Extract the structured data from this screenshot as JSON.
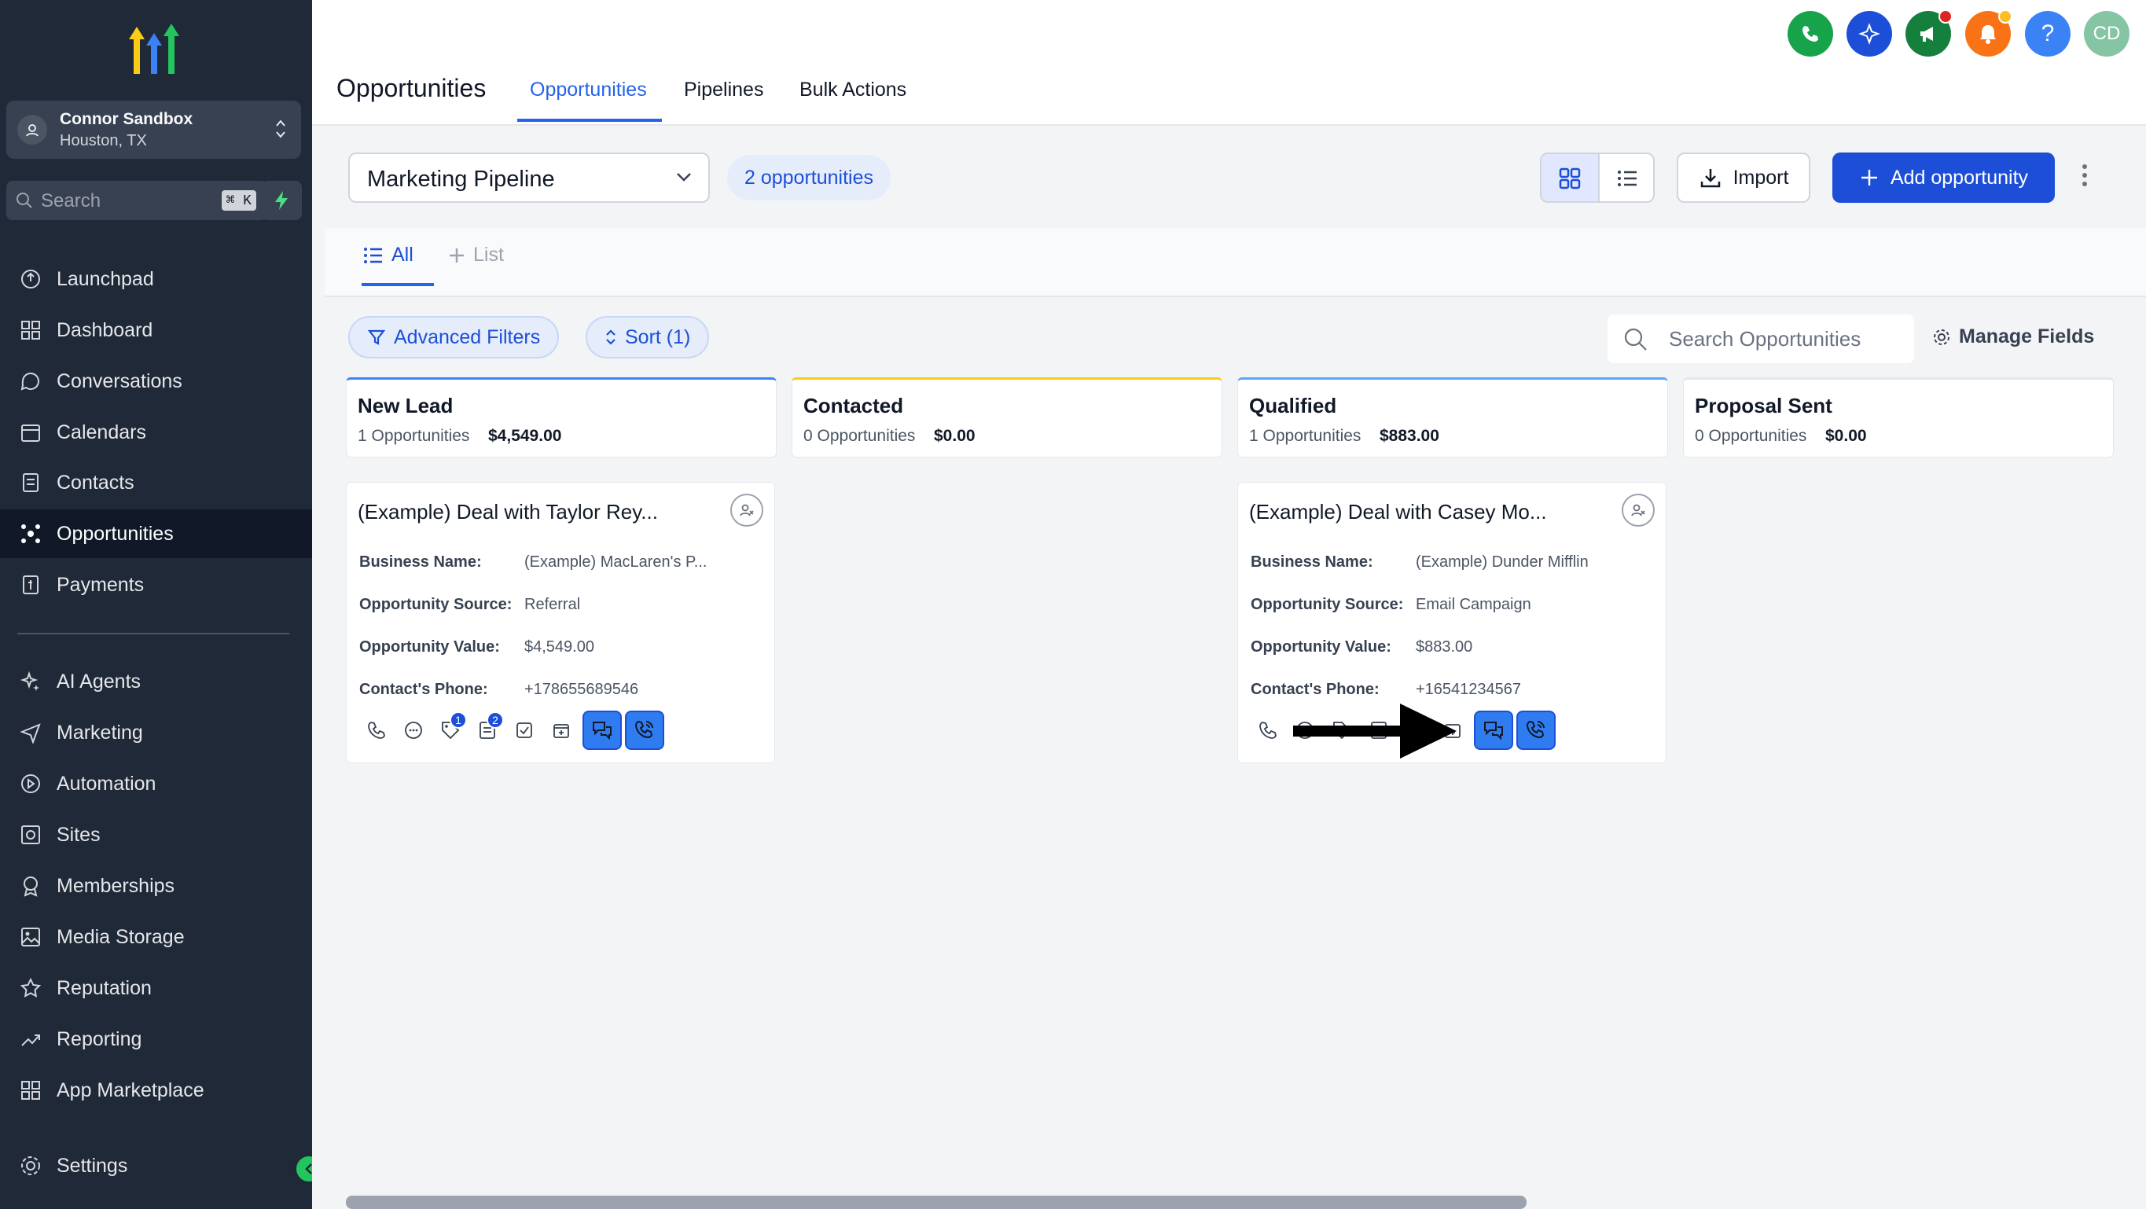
{
  "account": {
    "name": "Connor Sandbox",
    "location": "Houston, TX"
  },
  "search": {
    "placeholder": "Search",
    "shortcut": "⌘ K"
  },
  "sidebar": {
    "items": [
      {
        "label": "Launchpad",
        "icon": "launchpad-icon"
      },
      {
        "label": "Dashboard",
        "icon": "dashboard-icon"
      },
      {
        "label": "Conversations",
        "icon": "chat-icon"
      },
      {
        "label": "Calendars",
        "icon": "calendar-icon"
      },
      {
        "label": "Contacts",
        "icon": "contacts-icon"
      },
      {
        "label": "Opportunities",
        "icon": "opportunities-icon",
        "active": true
      },
      {
        "label": "Payments",
        "icon": "payments-icon"
      },
      {
        "label": "AI Agents",
        "icon": "sparkle-icon"
      },
      {
        "label": "Marketing",
        "icon": "send-icon"
      },
      {
        "label": "Automation",
        "icon": "automation-icon"
      },
      {
        "label": "Sites",
        "icon": "sites-icon"
      },
      {
        "label": "Memberships",
        "icon": "award-icon"
      },
      {
        "label": "Media Storage",
        "icon": "image-icon"
      },
      {
        "label": "Reputation",
        "icon": "star-icon"
      },
      {
        "label": "Reporting",
        "icon": "trend-icon"
      },
      {
        "label": "App Marketplace",
        "icon": "grid-icon"
      }
    ],
    "settings": "Settings"
  },
  "header": {
    "title": "Opportunities",
    "tabs": [
      "Opportunities",
      "Pipelines",
      "Bulk Actions"
    ],
    "avatar_initials": "CD"
  },
  "toolbar": {
    "pipeline": "Marketing Pipeline",
    "count": "2 opportunities",
    "import": "Import",
    "add": "Add opportunity"
  },
  "subtabs": {
    "all": "All",
    "list": "List"
  },
  "filters": {
    "advanced": "Advanced Filters",
    "sort": "Sort (1)",
    "search_placeholder": "Search Opportunities",
    "manage": "Manage Fields"
  },
  "columns": [
    {
      "title": "New Lead",
      "count": "1 Opportunities",
      "value": "$4,549.00",
      "color": "#3b82f6"
    },
    {
      "title": "Contacted",
      "count": "0 Opportunities",
      "value": "$0.00",
      "color": "#facc15"
    },
    {
      "title": "Qualified",
      "count": "1 Opportunities",
      "value": "$883.00",
      "color": "#60a5fa"
    },
    {
      "title": "Proposal Sent",
      "count": "0 Opportunities",
      "value": "$0.00",
      "color": "#e5e7eb"
    }
  ],
  "field_labels": {
    "business": "Business Name:",
    "source": "Opportunity Source:",
    "value": "Opportunity Value:",
    "phone": "Contact's Phone:"
  },
  "cards": [
    {
      "title": "(Example) Deal with Taylor Rey...",
      "business": "(Example) MacLaren's P...",
      "source": "Referral",
      "value": "$4,549.00",
      "phone": "+178655689546",
      "badges": [
        "1",
        "2"
      ]
    },
    {
      "title": "(Example) Deal with Casey Mo...",
      "business": "(Example) Dunder Mifflin",
      "source": "Email Campaign",
      "value": "$883.00",
      "phone": "+16541234567"
    }
  ]
}
